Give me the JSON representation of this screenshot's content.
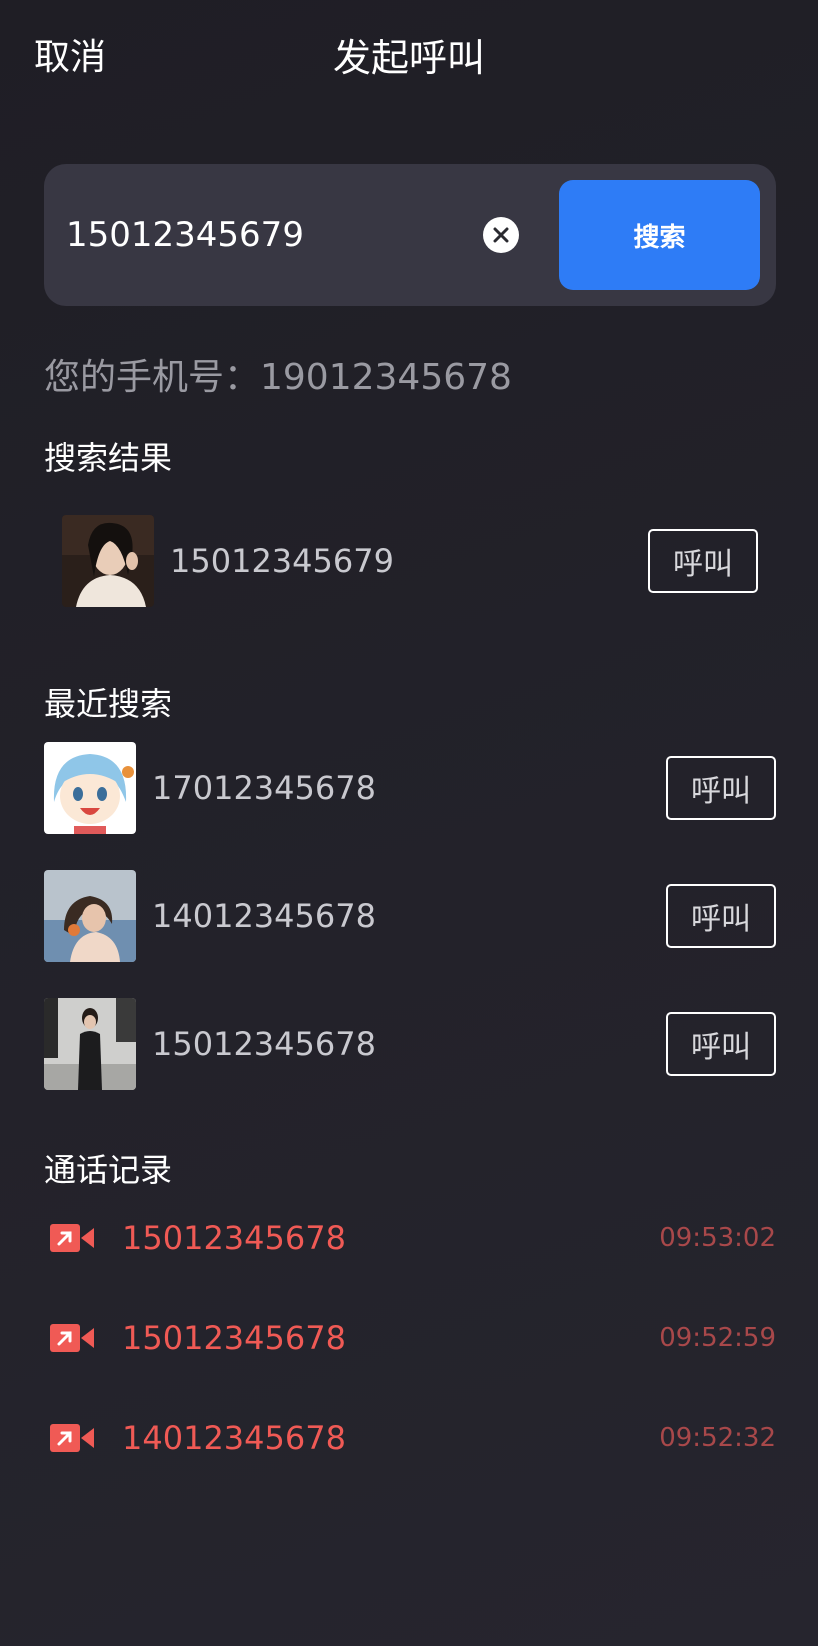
{
  "header": {
    "cancel_label": "取消",
    "title": "发起呼叫"
  },
  "search": {
    "value": "15012345679",
    "button_label": "搜索"
  },
  "my_phone_text": "您的手机号：19012345678",
  "results": {
    "title": "搜索结果",
    "items": [
      {
        "number": "15012345679",
        "call_label": "呼叫"
      }
    ]
  },
  "recent": {
    "title": "最近搜索",
    "items": [
      {
        "number": "17012345678",
        "call_label": "呼叫"
      },
      {
        "number": "14012345678",
        "call_label": "呼叫"
      },
      {
        "number": "15012345678",
        "call_label": "呼叫"
      }
    ]
  },
  "call_log": {
    "title": "通话记录",
    "items": [
      {
        "number": "15012345678",
        "time": "09:53:02",
        "icon": "video-call-icon"
      },
      {
        "number": "15012345678",
        "time": "09:52:59",
        "icon": "video-call-icon"
      },
      {
        "number": "14012345678",
        "time": "09:52:32",
        "icon": "video-call-icon"
      }
    ]
  },
  "colors": {
    "accent": "#2e7cf6",
    "missed": "#f05a55",
    "background": "#22212a",
    "panel": "#383743"
  }
}
